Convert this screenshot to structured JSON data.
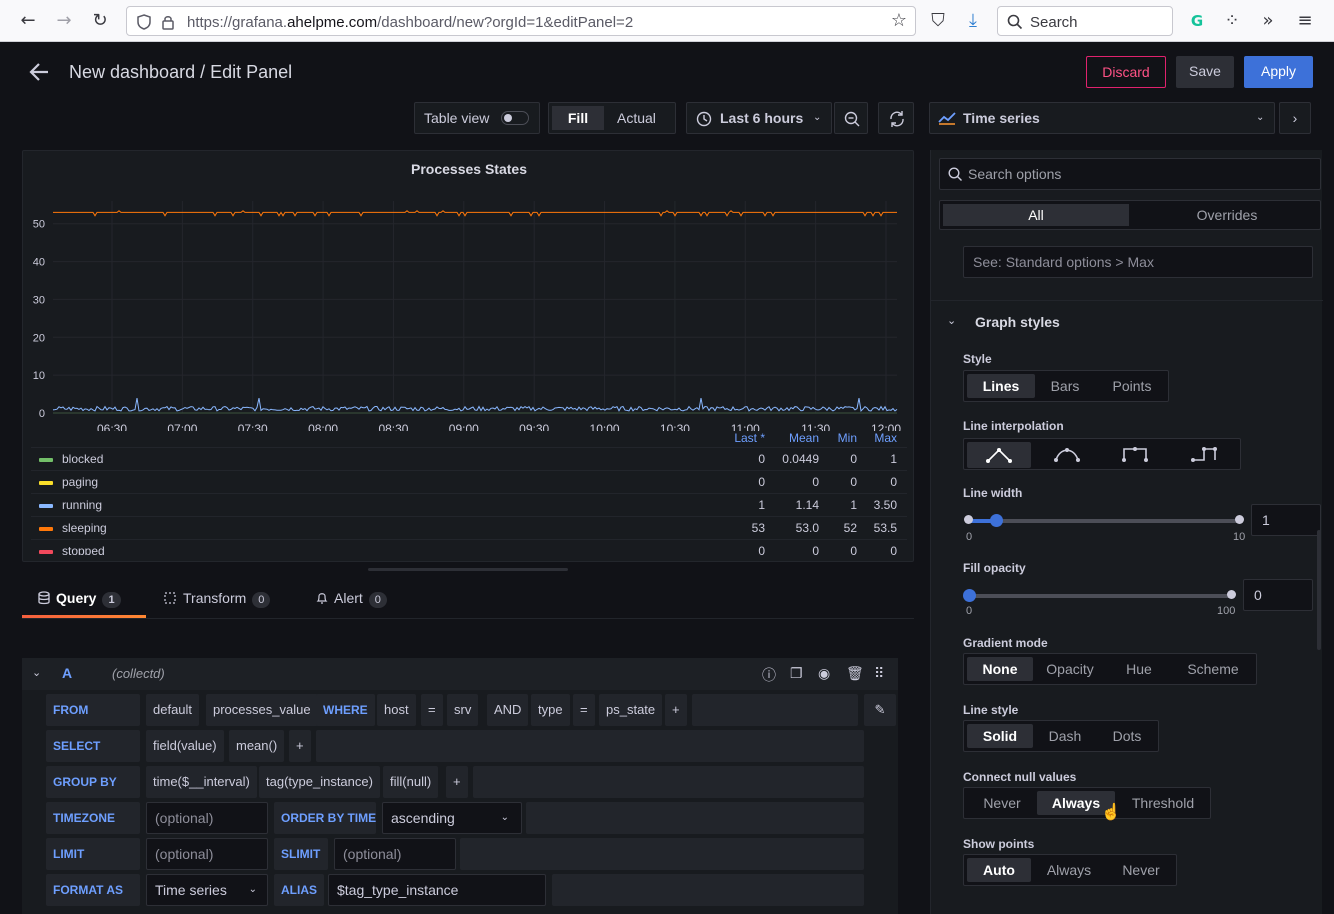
{
  "browser": {
    "url_prefix": "https://grafana.",
    "url_domain": "ahelpme.com",
    "url_path": "/dashboard/new?orgId=1&editPanel=2",
    "search_placeholder": "Search"
  },
  "header": {
    "title": "New dashboard / Edit Panel",
    "discard_label": "Discard",
    "save_label": "Save",
    "apply_label": "Apply"
  },
  "toolbar": {
    "table_view_label": "Table view",
    "fill_label": "Fill",
    "actual_label": "Actual",
    "time_range_label": "Last 6 hours",
    "visualization_label": "Time series"
  },
  "panel": {
    "title": "Processes States"
  },
  "chart_data": {
    "type": "line",
    "title": "Processes States",
    "x_ticks": [
      "06:30",
      "07:00",
      "07:30",
      "08:00",
      "08:30",
      "09:00",
      "09:30",
      "10:00",
      "10:30",
      "11:00",
      "11:30",
      "12:00"
    ],
    "y_ticks": [
      "0",
      "10",
      "20",
      "30",
      "40",
      "50"
    ],
    "ylim": [
      0,
      56
    ],
    "grid": true,
    "series": [
      {
        "name": "sleeping",
        "color": "#ff780a",
        "approx_value": 53
      },
      {
        "name": "running",
        "color": "#8ab8ff",
        "approx_value": 1.14
      }
    ]
  },
  "legend": {
    "headers": {
      "last": "Last *",
      "mean": "Mean",
      "min": "Min",
      "max": "Max"
    },
    "rows": [
      {
        "name": "blocked",
        "color": "#73bf69",
        "last": "0",
        "mean": "0.0449",
        "min": "0",
        "max": "1"
      },
      {
        "name": "paging",
        "color": "#fade2a",
        "last": "0",
        "mean": "0",
        "min": "0",
        "max": "0"
      },
      {
        "name": "running",
        "color": "#8ab8ff",
        "last": "1",
        "mean": "1.14",
        "min": "1",
        "max": "3.50"
      },
      {
        "name": "sleeping",
        "color": "#ff780a",
        "last": "53",
        "mean": "53.0",
        "min": "52",
        "max": "53.5"
      },
      {
        "name": "stopped",
        "color": "#f2495c",
        "last": "0",
        "mean": "0",
        "min": "0",
        "max": "0"
      }
    ]
  },
  "tabs": {
    "query": {
      "label": "Query",
      "count": "1"
    },
    "transform": {
      "label": "Transform",
      "count": "0"
    },
    "alert": {
      "label": "Alert",
      "count": "0"
    }
  },
  "query": {
    "ref": "A",
    "datasource": "(collectd)",
    "from": {
      "kw": "FROM",
      "policy": "default",
      "measurement": "processes_value",
      "where_kw": "WHERE",
      "tag1": "host",
      "op1": "=",
      "val1": "srv",
      "and_kw": "AND",
      "tag2": "type",
      "op2": "=",
      "val2": "ps_state",
      "plus": "+"
    },
    "select": {
      "kw": "SELECT",
      "field": "field(value)",
      "fn": "mean()",
      "plus": "+"
    },
    "groupby": {
      "kw": "GROUP BY",
      "time": "time($__interval)",
      "tag": "tag(type_instance)",
      "fill": "fill(null)",
      "plus": "+"
    },
    "timezone": {
      "kw": "TIMEZONE",
      "placeholder": "(optional)",
      "order_kw": "ORDER BY TIME",
      "order_value": "ascending"
    },
    "limit": {
      "kw": "LIMIT",
      "placeholder": "(optional)",
      "slimit_kw": "SLIMIT",
      "slimit_placeholder": "(optional)"
    },
    "format": {
      "kw": "FORMAT AS",
      "value": "Time series",
      "alias_kw": "ALIAS",
      "alias_value": "$tag_type_instance"
    }
  },
  "options": {
    "search_placeholder": "Search options",
    "tab_all": "All",
    "tab_overrides": "Overrides",
    "max_hint": "See: Standard options > Max",
    "section_title": "Graph styles",
    "style": {
      "label": "Style",
      "options": [
        "Lines",
        "Bars",
        "Points"
      ],
      "selected": "Lines"
    },
    "line_interpolation": {
      "label": "Line interpolation"
    },
    "line_width": {
      "label": "Line width",
      "min": "0",
      "max": "10",
      "value": "1"
    },
    "fill_opacity": {
      "label": "Fill opacity",
      "min": "0",
      "max": "100",
      "value": "0"
    },
    "gradient_mode": {
      "label": "Gradient mode",
      "options": [
        "None",
        "Opacity",
        "Hue",
        "Scheme"
      ],
      "selected": "None"
    },
    "line_style": {
      "label": "Line style",
      "options": [
        "Solid",
        "Dash",
        "Dots"
      ],
      "selected": "Solid"
    },
    "connect_null": {
      "label": "Connect null values",
      "options": [
        "Never",
        "Always",
        "Threshold"
      ],
      "selected": "Always"
    },
    "show_points": {
      "label": "Show points",
      "options": [
        "Auto",
        "Always",
        "Never"
      ],
      "selected": "Auto"
    }
  }
}
